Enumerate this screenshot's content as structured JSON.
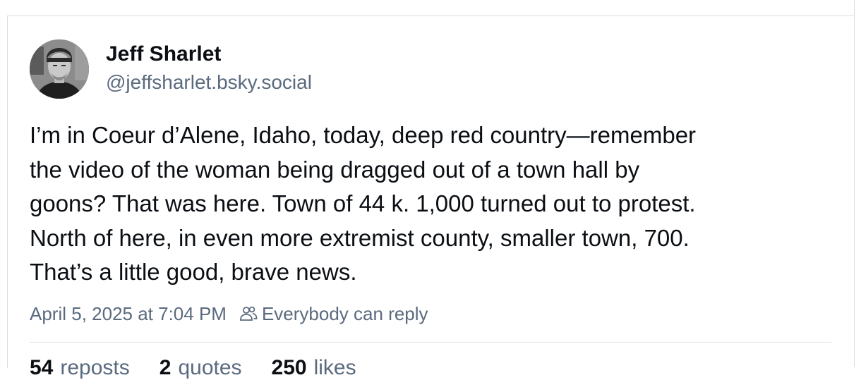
{
  "post": {
    "author": {
      "name": "Jeff Sharlet",
      "handle": "@jeffsharlet.bsky.social",
      "avatar_icon": "person-portrait-photo"
    },
    "body_lines": [
      "I’m in Coeur d’Alene, Idaho, today, deep red country—remember",
      "the video of the woman being dragged out of a town hall by",
      "goons? That was here. Town of 44 k. 1,000 turned out to protest.",
      "North of here, in even more extremist county, smaller town, 700.",
      "That’s a little good, brave news."
    ],
    "timestamp": "April 5, 2025 at 7:04 PM",
    "reply_setting": {
      "icon": "people-icon",
      "label": "Everybody can reply"
    },
    "stats": [
      {
        "count": "54",
        "label": "reposts"
      },
      {
        "count": "2",
        "label": "quotes"
      },
      {
        "count": "250",
        "label": "likes"
      }
    ]
  },
  "colors": {
    "text": "#0b0f14",
    "muted": "#5a6a7e",
    "rule": "#d9dde2"
  }
}
